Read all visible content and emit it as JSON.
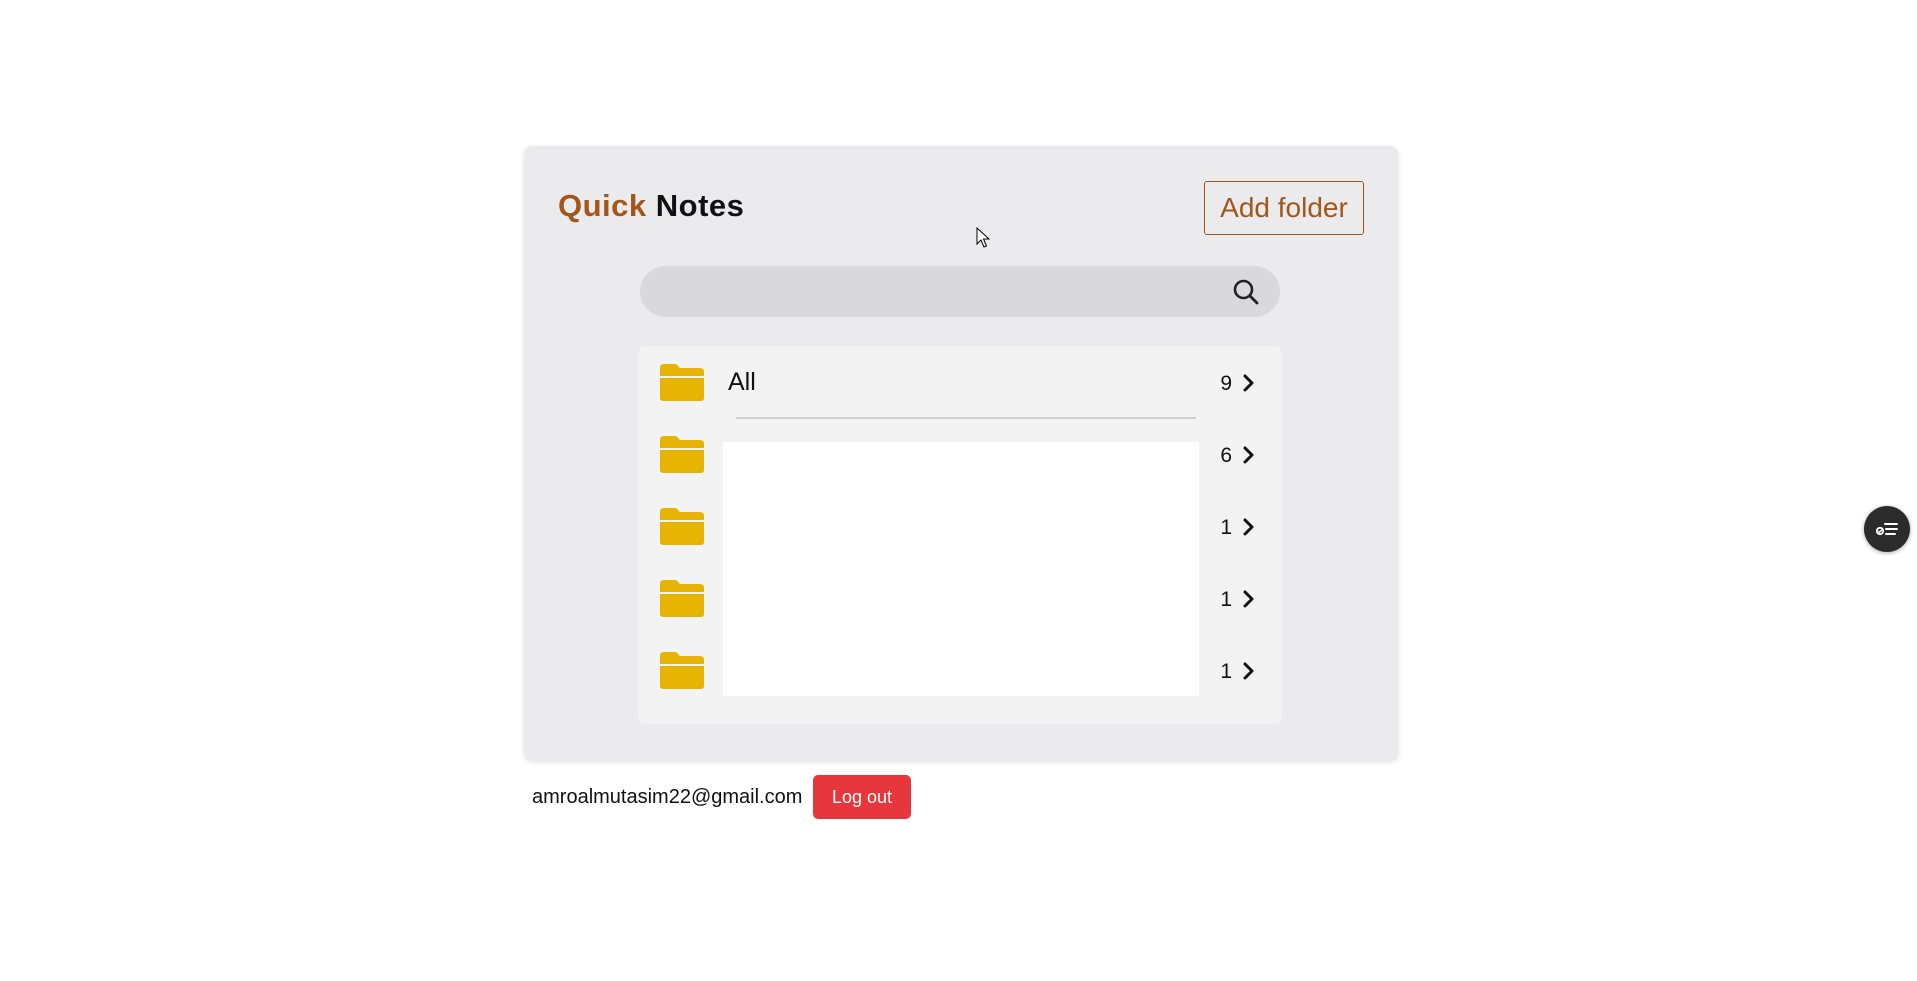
{
  "app": {
    "title_part1": "Quick",
    "title_part2": "Notes",
    "accent_color": "#a4561a"
  },
  "header": {
    "add_folder_label": "Add folder"
  },
  "search": {
    "placeholder": "",
    "icon": "search-icon"
  },
  "folders": [
    {
      "name": "All",
      "count": "9",
      "icon": "folder-icon"
    },
    {
      "name": "",
      "count": "6",
      "icon": "folder-icon"
    },
    {
      "name": "",
      "count": "1",
      "icon": "folder-icon"
    },
    {
      "name": "",
      "count": "1",
      "icon": "folder-icon"
    },
    {
      "name": "",
      "count": "1",
      "icon": "folder-icon"
    }
  ],
  "footer": {
    "email": "amroalmutasim22@gmail.com",
    "logout_label": "Log out",
    "logout_color": "#e8373c"
  },
  "floating_button": {
    "icon": "task-list-icon"
  }
}
